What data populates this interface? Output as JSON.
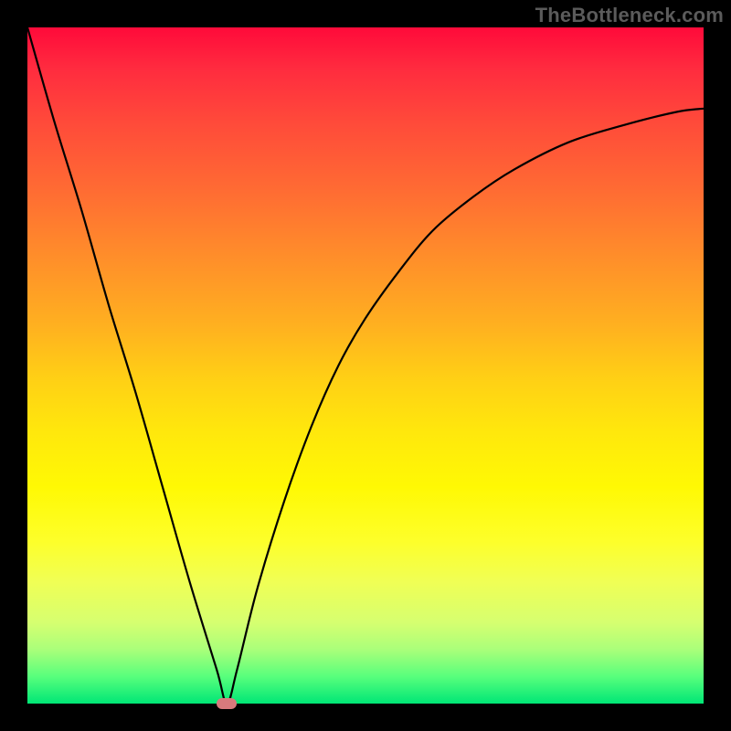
{
  "watermark": "TheBottleneck.com",
  "chart_data": {
    "type": "line",
    "title": "",
    "xlabel": "",
    "ylabel": "",
    "xlim": [
      0,
      100
    ],
    "ylim": [
      0,
      100
    ],
    "grid": false,
    "legend": false,
    "series": [
      {
        "name": "curve",
        "x": [
          0,
          4,
          8,
          12,
          16,
          20,
          24,
          28,
          29.5,
          31,
          34,
          38,
          42,
          46,
          50,
          55,
          60,
          66,
          72,
          80,
          88,
          96,
          100
        ],
        "values": [
          100,
          86,
          73,
          59,
          46,
          32,
          18,
          5,
          0,
          5,
          17,
          30,
          41,
          50,
          57,
          64,
          70,
          75,
          79,
          83,
          85.5,
          87.5,
          88
        ]
      }
    ],
    "min_marker": {
      "x": 29.5,
      "y": 0
    },
    "background_gradient": {
      "top": "#ff0a3a",
      "mid": "#ffd015",
      "bottom": "#00e676"
    },
    "curve_color": "#000000",
    "marker_color": "#d87a7d"
  }
}
